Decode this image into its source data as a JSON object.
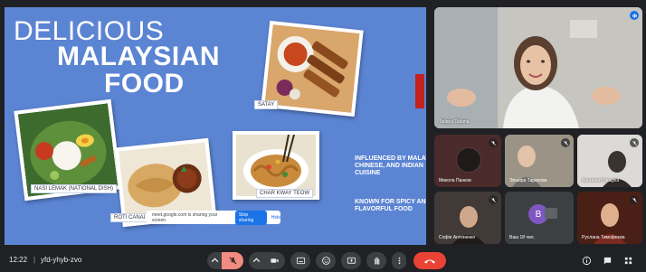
{
  "slide": {
    "title_line1": "DELICIOUS",
    "title_line2": "MALAYSIAN",
    "title_line3": "FOOD",
    "captions": {
      "satay": "SATAY",
      "nasi_lemak": "NASI LEMAK (NATIONAL DISH)",
      "roti_canai": "ROTI CANAI",
      "char_kway_teow": "CHAR KWAY TEOW"
    },
    "influence_text": "INFLUENCED BY MALAY, CHINESE, AND INDIAN CUISINE",
    "known_text": "KNOWN FOR SPICY AND FLAVORFUL FOOD"
  },
  "share_bar": {
    "message": "meet.google.com is sharing your screen.",
    "stop_label": "Stop sharing",
    "hide_label": "Hide"
  },
  "participants": {
    "main": {
      "name": "Tatiana Tatiana"
    },
    "tiles": [
      {
        "name": "Микола Панков"
      },
      {
        "name": "Эльвіра Тарахова"
      },
      {
        "name": "Ангеліна Грищука"
      },
      {
        "name": "Софія Антоненко"
      },
      {
        "name": "Ваш 18 чел.",
        "initial": "В"
      },
      {
        "name": "Руслана Тимофеєва"
      }
    ]
  },
  "bottom_bar": {
    "time": "12:22",
    "separator": "|",
    "meeting_code": "yfd-yhyb-zvo"
  },
  "colors": {
    "slide_bg": "#5b84d3",
    "meet_bg": "#202124",
    "end_call": "#ea4335",
    "mic_off": "#f28b82"
  }
}
